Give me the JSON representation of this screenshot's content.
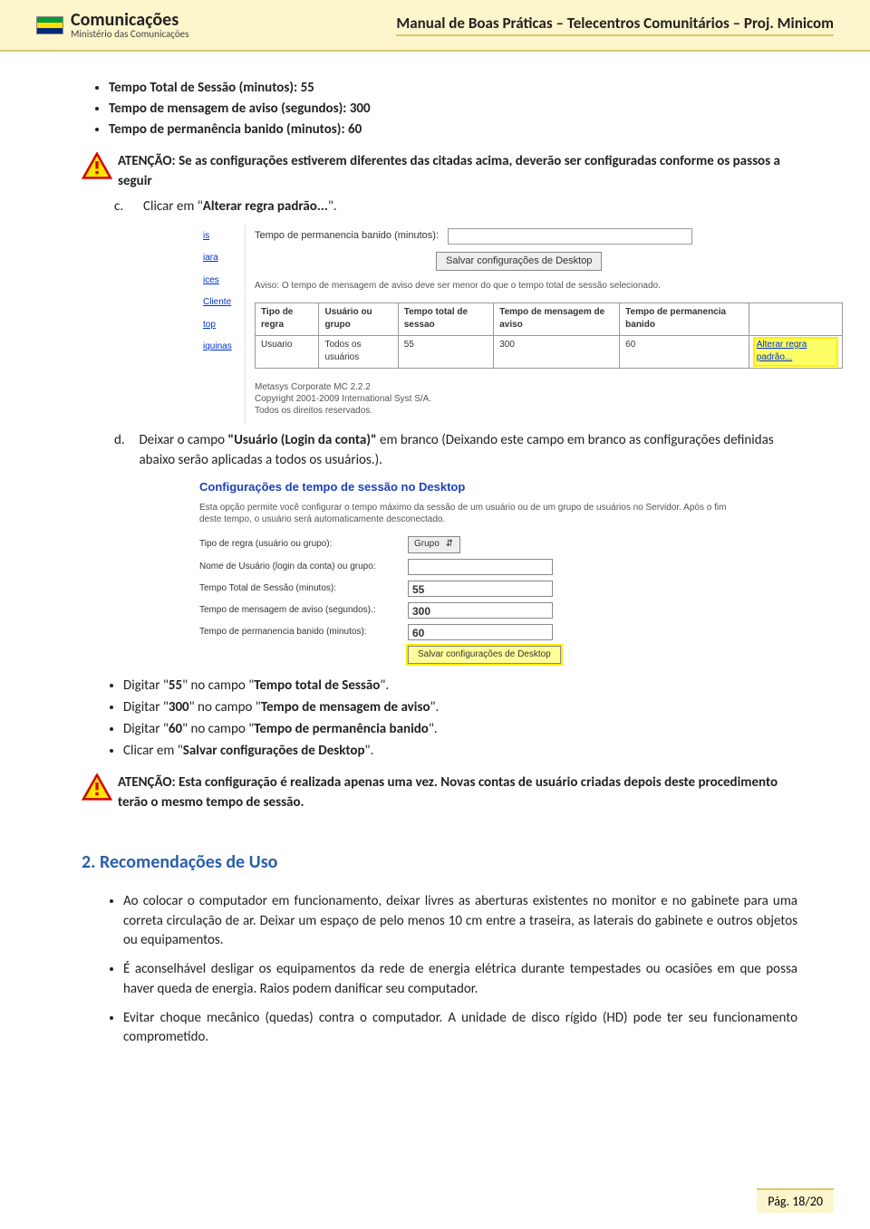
{
  "header": {
    "logo_title": "Comunicações",
    "logo_sub": "Ministério das Comunicações",
    "doc_title": "Manual de Boas Práticas – Telecentros Comunitários – Proj. Minicom"
  },
  "top_bullets": [
    {
      "label": "Tempo Total de Sessão (minutos):",
      "value": "55"
    },
    {
      "label": "Tempo de mensagem de aviso (segundos):",
      "value": "300"
    },
    {
      "label": "Tempo de permanência banido (minutos):",
      "value": "60"
    }
  ],
  "warn1": {
    "label": "ATENÇÃO:",
    "text": "Se as configurações estiverem diferentes das citadas acima, deverão ser configuradas conforme os passos a seguir"
  },
  "step_c": {
    "letter": "c.",
    "pre": "Clicar em \"",
    "bold": "Alterar regra padrão...",
    "post": "\"."
  },
  "ss1": {
    "side": [
      "is",
      "iara",
      "ices",
      "Cliente",
      "top",
      "iquinas"
    ],
    "row1_label": "Tempo de permanencia banido (minutos):",
    "save_btn": "Salvar configurações de Desktop",
    "aviso": "Aviso: O tempo de mensagem de aviso deve ser menor do que o tempo total de sessão selecionado.",
    "table": {
      "headers": [
        "Tipo de regra",
        "Usuário ou grupo",
        "Tempo total de sessao",
        "Tempo de mensagem de aviso",
        "Tempo de permanencia banido",
        ""
      ],
      "row": [
        "Usuario",
        "Todos os usuários",
        "55",
        "300",
        "60"
      ],
      "link": "Alterar regra padrão..."
    },
    "footer": [
      "Metasys Corporate MC 2.2.2",
      "Copyright 2001-2009 International Syst S/A.",
      "Todos os direitos reservados."
    ]
  },
  "step_d": {
    "letter": "d.",
    "pre": "Deixar o campo ",
    "bold": "\"Usuário (Login da conta)\"",
    "post": " em branco (Deixando este campo em branco as configurações definidas abaixo serão aplicadas a todos os usuários.)."
  },
  "ss2": {
    "title": "Configurações de tempo de sessão no Desktop",
    "desc": "Esta opção permite você configurar o tempo máximo da sessão de um usuário ou de um grupo de usuários no Servidor. Após o fim deste tempo, o usuário será automaticamente desconectado.",
    "rows": [
      {
        "label": "Tipo de regra (usuário ou grupo):",
        "type": "select",
        "value": "Grupo"
      },
      {
        "label": "Nome de Usuário (login da conta) ou grupo:",
        "type": "text",
        "value": ""
      },
      {
        "label": "Tempo Total de Sessão (minutos):",
        "type": "text",
        "value": "55"
      },
      {
        "label": "Tempo de mensagem de aviso (segundos).:",
        "type": "text",
        "value": "300"
      },
      {
        "label": "Tempo de permanencia banido (minutos):",
        "type": "text",
        "value": "60"
      }
    ],
    "save_btn": "Salvar configurações de Desktop"
  },
  "mid_bullets": [
    {
      "pre": "Digitar \"",
      "v": "55",
      "mid": "\" no campo \"",
      "field": "Tempo total de Sessão",
      "post": "\"."
    },
    {
      "pre": "Digitar \"",
      "v": "300",
      "mid": "\" no campo \"",
      "field": "Tempo de mensagem de aviso",
      "post": "\"."
    },
    {
      "pre": "Digitar \"",
      "v": "60",
      "mid": "\" no campo \"",
      "field": "Tempo de permanência banido",
      "post": "\"."
    },
    {
      "pre": "Clicar em \"",
      "v": "",
      "mid": "",
      "field": "Salvar configurações de Desktop",
      "post": "\"."
    }
  ],
  "warn2": {
    "label": "ATENÇÃO:",
    "text": "Esta configuração é realizada apenas uma vez. Novas contas de usuário criadas depois deste procedimento terão o mesmo tempo de sessão."
  },
  "section2": {
    "heading": "2.  Recomendações de Uso",
    "items": [
      "Ao colocar o computador em funcionamento, deixar livres as aberturas existentes no monitor e no gabinete para uma correta circulação de ar. Deixar um espaço de pelo menos 10 cm entre a traseira, as laterais do gabinete e outros objetos ou equipamentos.",
      "É aconselhável desligar os equipamentos da rede de energia elétrica durante tempestades ou ocasiões em que possa haver queda de energia. Raios podem danificar seu computador.",
      "Evitar choque mecânico (quedas) contra o computador. A unidade de disco rígido (HD) pode ter seu funcionamento comprometido."
    ]
  },
  "footer": {
    "label": "Pág. 18/20"
  }
}
